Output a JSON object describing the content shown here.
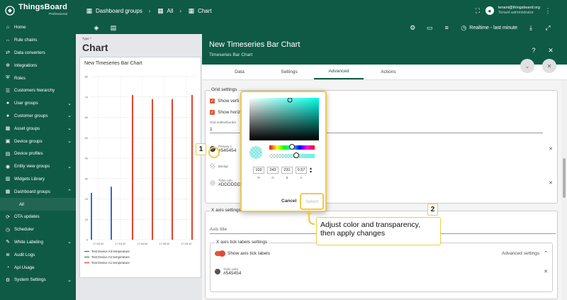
{
  "app": {
    "brand": "ThingsBoard",
    "brand_sub": "Professional"
  },
  "breadcrumb": [
    "Dashboard groups",
    "All",
    "Chart"
  ],
  "user": {
    "email": "tenant@thingsboard.org",
    "role": "Tenant administrator"
  },
  "toolbar": {
    "time_label": "Realtime - last minute"
  },
  "sidebar": {
    "items": [
      {
        "label": "Home",
        "icon": "home-icon",
        "chevron": false
      },
      {
        "label": "Rule chains",
        "icon": "rule-chains-icon",
        "chevron": false
      },
      {
        "label": "Data converters",
        "icon": "converter-icon",
        "chevron": false
      },
      {
        "label": "Integrations",
        "icon": "integration-icon",
        "chevron": false
      },
      {
        "label": "Roles",
        "icon": "shield-icon",
        "chevron": false
      },
      {
        "label": "Customers hierarchy",
        "icon": "hierarchy-icon",
        "chevron": false
      },
      {
        "label": "User groups",
        "icon": "users-icon",
        "chevron": true
      },
      {
        "label": "Customer groups",
        "icon": "customers-icon",
        "chevron": true
      },
      {
        "label": "Asset groups",
        "icon": "asset-icon",
        "chevron": true
      },
      {
        "label": "Device groups",
        "icon": "device-icon",
        "chevron": true
      },
      {
        "label": "Device profiles",
        "icon": "device-profile-icon",
        "chevron": false
      },
      {
        "label": "Entity view groups",
        "icon": "entity-view-icon",
        "chevron": true
      },
      {
        "label": "Widgets Library",
        "icon": "widgets-icon",
        "chevron": false
      },
      {
        "label": "Dashboard groups",
        "icon": "dashboard-icon",
        "chevron": true
      },
      {
        "label": "All",
        "icon": "",
        "chevron": false
      },
      {
        "label": "OTA updates",
        "icon": "ota-icon",
        "chevron": false
      },
      {
        "label": "Scheduler",
        "icon": "scheduler-icon",
        "chevron": false
      },
      {
        "label": "White Labeling",
        "icon": "palette-icon",
        "chevron": true
      },
      {
        "label": "Audit Logs",
        "icon": "audit-icon",
        "chevron": false
      },
      {
        "label": "Api Usage",
        "icon": "api-usage-icon",
        "chevron": false
      },
      {
        "label": "System Settings",
        "icon": "gear-icon",
        "chevron": true
      }
    ]
  },
  "dashboard": {
    "type_label": "Type *",
    "title": "Chart",
    "widget_title": "New Timeseries Bar Chart"
  },
  "chart_data": {
    "type": "bar",
    "title": "New Timeseries Bar Chart",
    "ylim": [
      0,
      80
    ],
    "yticks": [
      "0",
      "10",
      "20",
      "30",
      "40",
      "50",
      "60",
      "70",
      "80"
    ],
    "xticks": [
      "17:04:30",
      "17:04:40",
      "17:04:50",
      "17:05:00",
      "17:05:10"
    ],
    "x": [
      0,
      1,
      2,
      3,
      4,
      5
    ],
    "series": [
      {
        "name": "Test Device A3 temperature",
        "color": "#2c6fce",
        "values": [
          23,
          26,
          26,
          26,
          26,
          25
        ]
      },
      {
        "name": "Test Device A2 temperature",
        "color": "#3a9d3e",
        "values": [
          0,
          0,
          38,
          30,
          30,
          30
        ]
      },
      {
        "name": "Test Device A1 temperature",
        "color": "#e0452c",
        "values": [
          0,
          0,
          71,
          69,
          69,
          71
        ]
      }
    ]
  },
  "panel": {
    "title": "New Timeseries Bar Chart",
    "subtitle": "Timeseries Bar Chart",
    "tabs": [
      "Data",
      "Settings",
      "Advanced",
      "Actions"
    ],
    "active_tab": "Advanced"
  },
  "grid_settings": {
    "legend": "Grid settings",
    "show_vertical": "Show verti",
    "show_horizontal": "Show horiz",
    "outline_label": "Grid outline/border",
    "outline_value": "1",
    "primary_color_label": "Primary c",
    "primary_color_value": "#545454",
    "background_label": "Backgr",
    "ticks_color_label": "Ticks colo",
    "ticks_color_value": "#DDDDDD"
  },
  "x_axis": {
    "legend": "X axis settings",
    "axis_title_placeholder": "Axis title",
    "tick_legend": "X axis tick labels settings",
    "show_tick_labels": "Show axis tick labels",
    "advanced": "Advanced settings",
    "ticks_color_label": "Ticks color",
    "ticks_color_value": "#545454"
  },
  "color_picker": {
    "r": "102",
    "g": "243",
    "b": "231",
    "a": "0.57",
    "r_label": "R",
    "g_label": "G",
    "b_label": "B",
    "a_label": "A",
    "cancel": "Cancel",
    "select": "Select",
    "accent": "#66f3e7"
  },
  "steps": {
    "one": "1",
    "two": "2",
    "callout": "Adjust color and transparency, then apply changes"
  },
  "colors": {
    "brand": "#0f5a45",
    "accent": "#e25a34",
    "highlight": "#f2c84b"
  }
}
